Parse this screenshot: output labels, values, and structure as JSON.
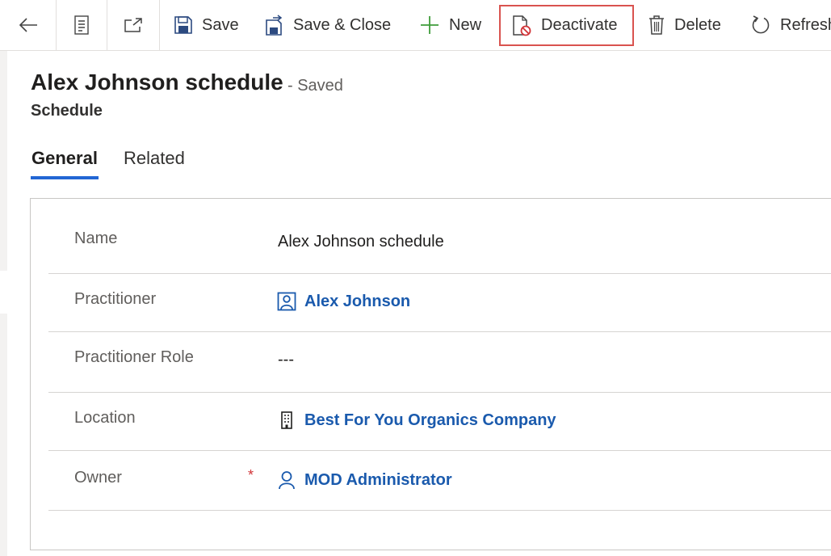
{
  "toolbar": {
    "save_label": "Save",
    "save_close_label": "Save & Close",
    "new_label": "New",
    "deactivate_label": "Deactivate",
    "delete_label": "Delete",
    "refresh_label": "Refresh"
  },
  "header": {
    "title": "Alex Johnson schedule",
    "status": "- Saved",
    "entity": "Schedule"
  },
  "tabs": [
    {
      "label": "General"
    },
    {
      "label": "Related"
    }
  ],
  "form": {
    "fields": [
      {
        "label": "Name",
        "value": "Alex Johnson schedule"
      },
      {
        "label": "Practitioner",
        "value": "Alex Johnson"
      },
      {
        "label": "Practitioner Role",
        "value": "---"
      },
      {
        "label": "Location",
        "value": "Best For You Organics Company"
      },
      {
        "label": "Owner",
        "value": "MOD Administrator",
        "required_marker": "*"
      }
    ]
  },
  "colors": {
    "accent": "#2266d4",
    "link": "#1a5aad",
    "highlight_border": "#d9534f",
    "required": "#d13438"
  }
}
